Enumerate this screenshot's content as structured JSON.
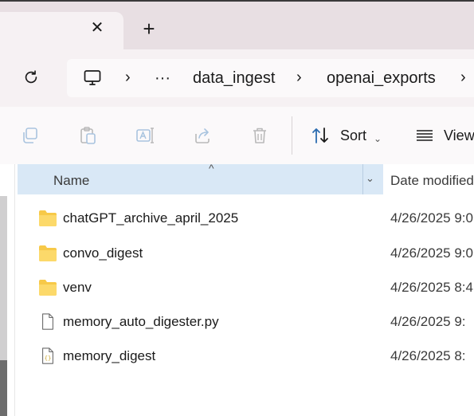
{
  "tabs": {
    "close_glyph": "✕",
    "new_tab_glyph": "+"
  },
  "address_bar": {
    "overflow": "···",
    "crumbs": [
      "data_ingest",
      "openai_exports"
    ]
  },
  "toolbar": {
    "sort_label": "Sort",
    "view_label": "View"
  },
  "file_list": {
    "columns": {
      "name": "Name",
      "date": "Date modified"
    },
    "rows": [
      {
        "name": "chatGPT_archive_april_2025",
        "date": "4/26/2025 9:0",
        "type": "folder"
      },
      {
        "name": "convo_digest",
        "date": "4/26/2025 9:0",
        "type": "folder"
      },
      {
        "name": "venv",
        "date": "4/26/2025 8:4",
        "type": "folder"
      },
      {
        "name": "memory_auto_digester.py",
        "date": "4/26/2025 9:",
        "type": "file"
      },
      {
        "name": "memory_digest",
        "date": "4/26/2025 8:",
        "type": "json-file"
      }
    ]
  },
  "colors": {
    "header_selected": "#d9e8f6",
    "folder_yellow": "#f7c948",
    "tab_strip": "#e8dfe3"
  }
}
